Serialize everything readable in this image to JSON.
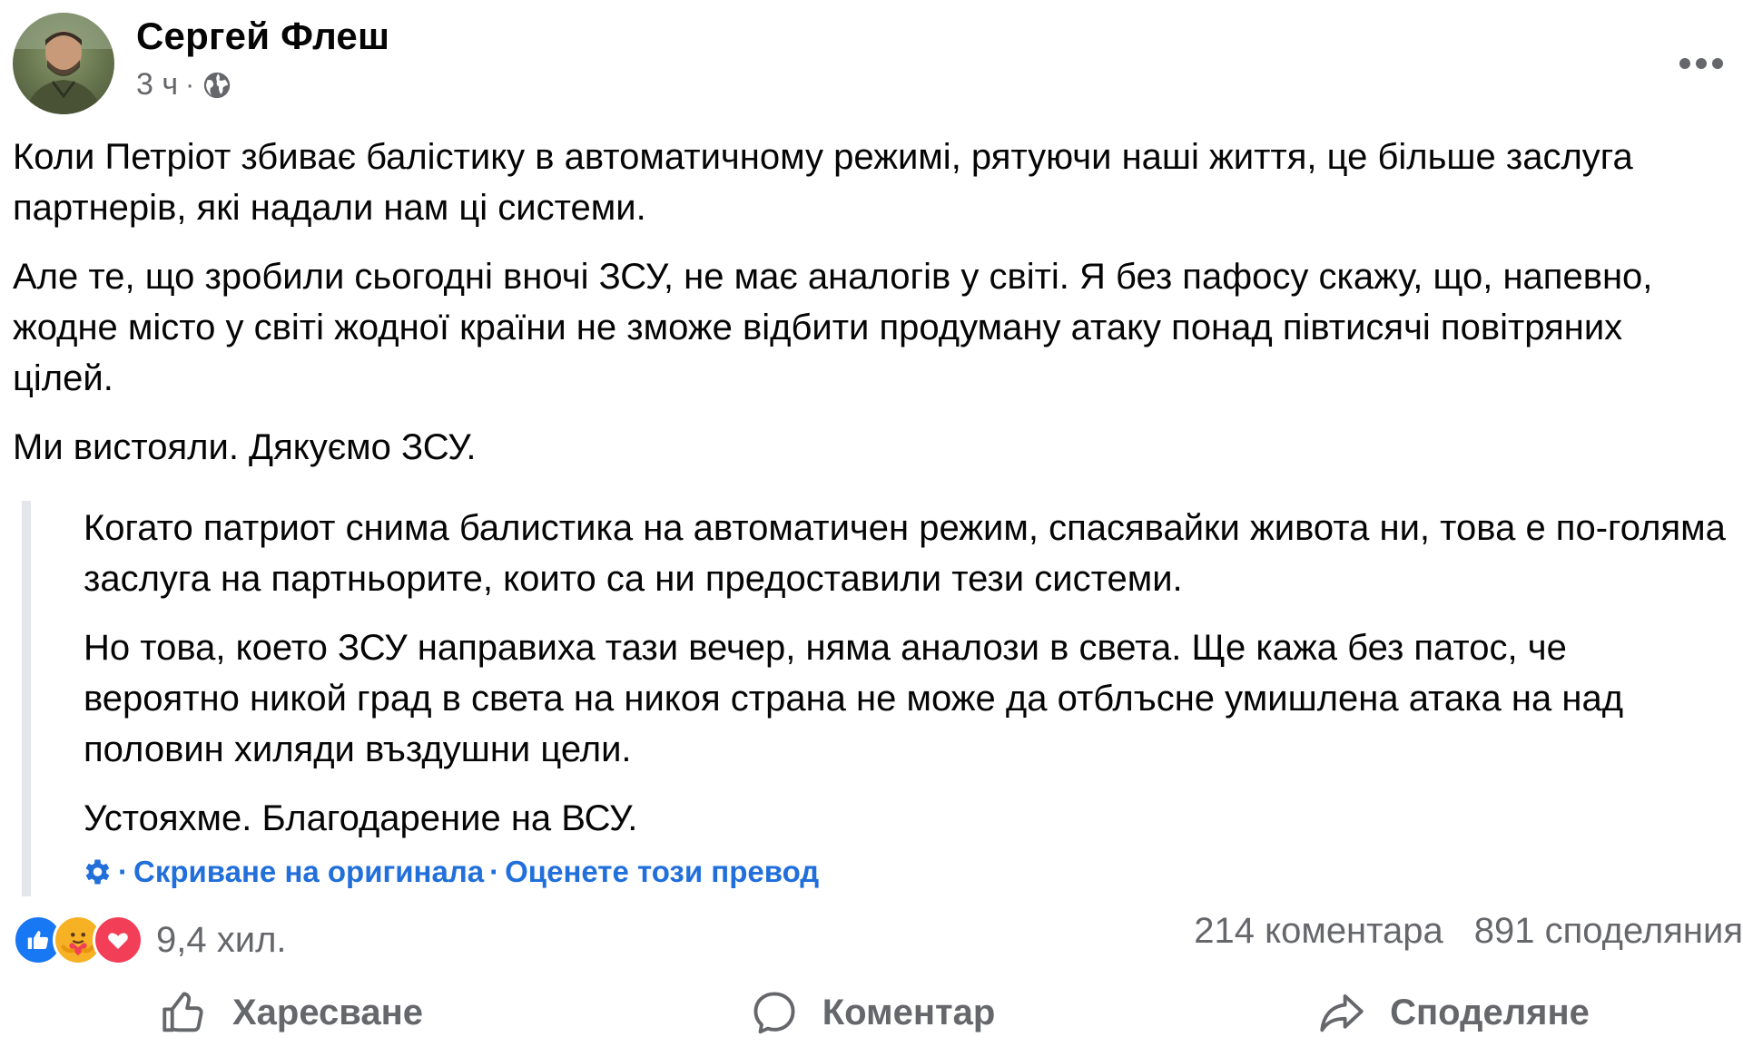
{
  "post": {
    "author": {
      "name": "Сергей Флеш"
    },
    "meta": {
      "time": "3 ч",
      "separator": "·",
      "audience_icon": "globe-icon"
    },
    "original_paragraphs": [
      "Коли Петріот збиває балістику в автоматичному режимі, рятуючи наші життя, це більше заслуга партнерів, які надали нам ці системи.",
      "Але те, що зробили сьогодні вночі ЗСУ, не має аналогів у світі. Я без пафосу скажу, що, напевно, жодне місто у світі жодної країни не зможе відбити продуману атаку понад півтисячі повітряних цілей.",
      "Ми вистояли. Дякуємо ЗСУ."
    ],
    "translation_paragraphs": [
      "Когато патриот снима балистика на автоматичен режим, спасявайки живота ни, това е по-голяма заслуга на партньорите, които са ни предоставили тези системи.",
      "Но това, което ЗСУ направиха тази вечер, няма аналози в света. Ще кажа без патос, че вероятно никой град в света на никоя страна не може да отблъсне умишлена атака на над половин хиляди въздушни цели.",
      "Устояхме. Благодарение на ВСУ."
    ],
    "translation_footer": {
      "separator1": "·",
      "hide_original": "Скриване на оригинала",
      "separator2": "·",
      "rate_translation": "Оценете този превод"
    },
    "reactions": {
      "icons": [
        "like-icon",
        "care-icon",
        "love-icon"
      ],
      "count": "9,4 хил."
    },
    "stats": {
      "comments": "214 коментара",
      "shares": "891 споделяния"
    },
    "actions": {
      "like": "Харесване",
      "comment": "Коментар",
      "share": "Споделяне"
    }
  },
  "colors": {
    "link": "#216fdb",
    "secondary_text": "#65676b",
    "like_blue": "#1877f2",
    "love_red": "#f33e58",
    "care_yellow": "#f7b125"
  }
}
